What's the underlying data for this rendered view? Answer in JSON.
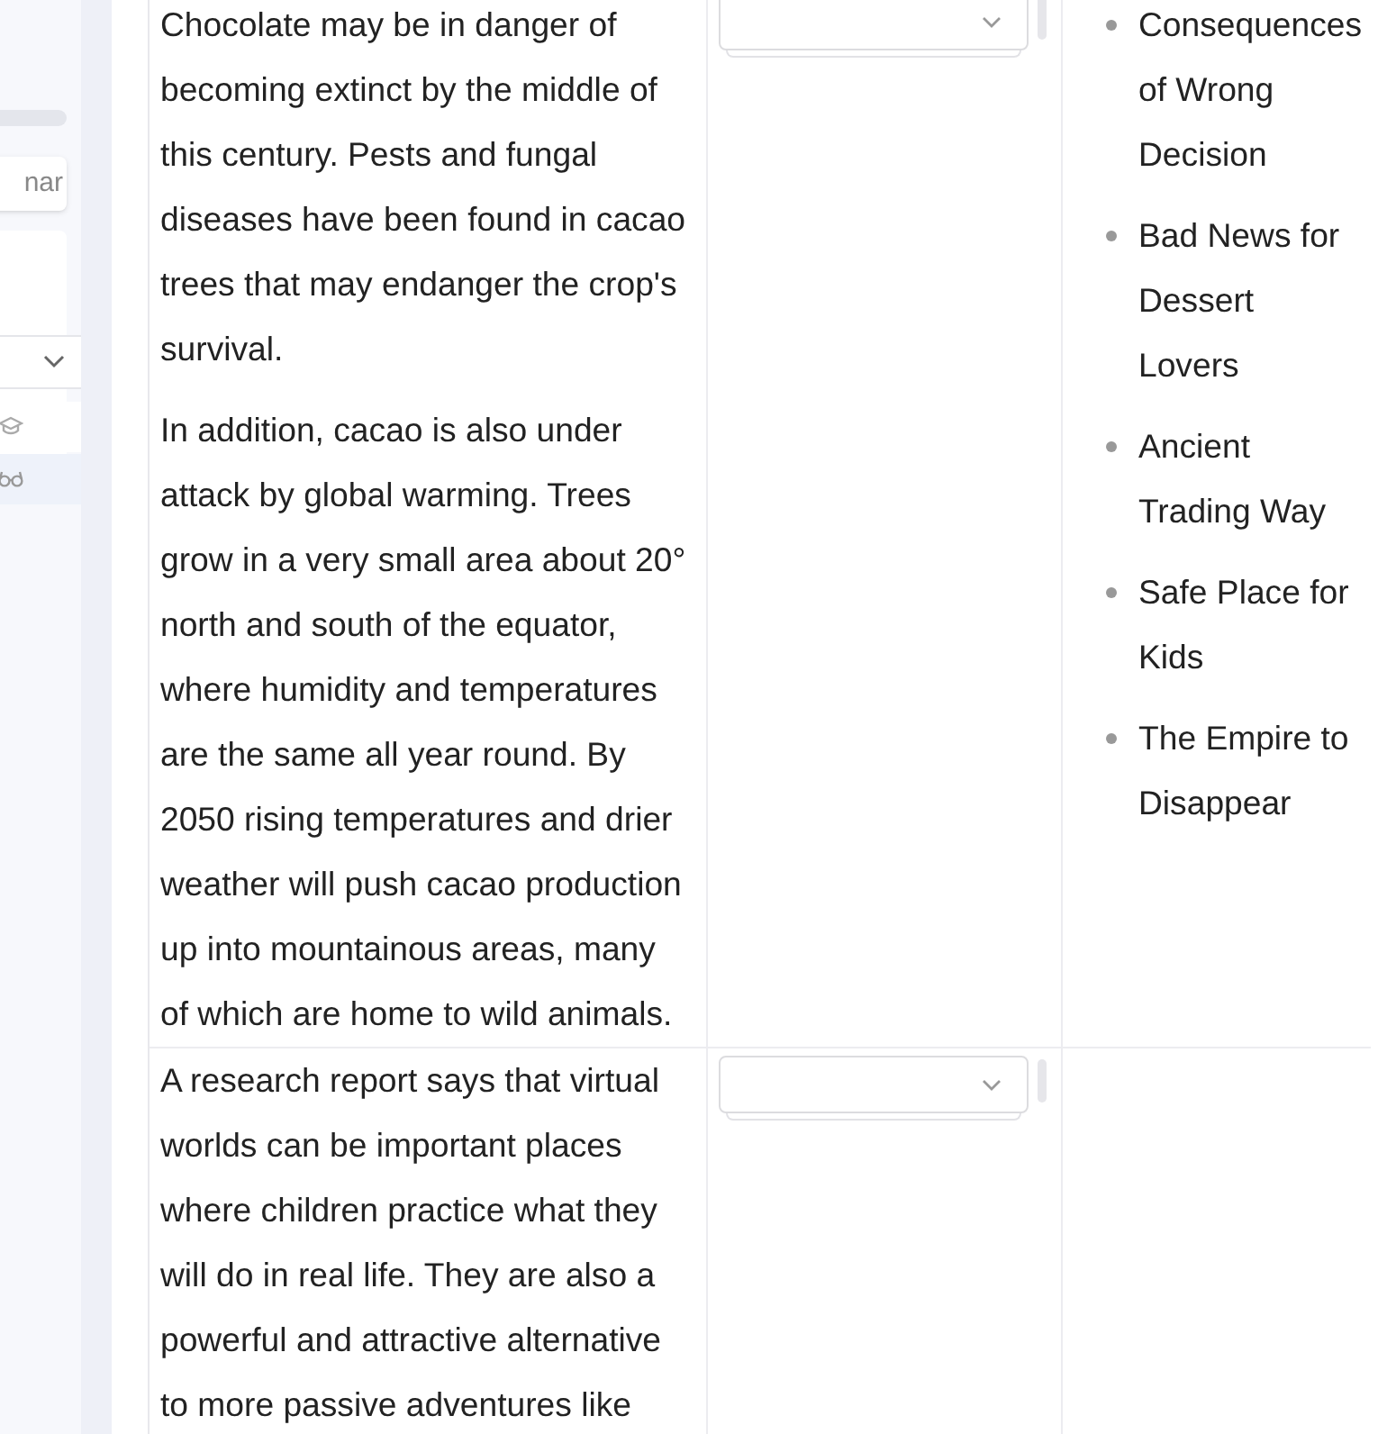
{
  "sidebar": {
    "button_fragment": "nar",
    "items": [
      {
        "kind": "cap",
        "selected": false
      },
      {
        "kind": "glasses",
        "selected": true
      }
    ]
  },
  "rows": [
    {
      "paragraphs": [
        [
          "Chocolate may be in danger of",
          "becoming extinct by the middle of",
          "this century. Pests and fungal",
          "diseases have been found in cacao",
          "trees that may endanger the crop's",
          "survival."
        ],
        [
          "In addition, cacao is also under",
          "attack by global warming. Trees",
          "grow in a very small area about 20°",
          "north and south of the equator,",
          "where humidity and temperatures",
          "are the same all year round. By",
          "2050 rising temperatures and drier",
          "weather will push cacao production",
          "up into mountainous areas, many",
          "of which are home to wild animals."
        ]
      ],
      "options": [
        [
          "Consequences",
          "of Wrong",
          "Decision"
        ],
        [
          "Bad News for",
          "Dessert",
          "Lovers"
        ],
        [
          "Ancient",
          "Trading Way"
        ],
        [
          "Safe Place for",
          "Kids"
        ],
        [
          "The Empire to",
          "Disappear"
        ]
      ]
    },
    {
      "paragraphs": [
        [
          "A research report says that virtual",
          "worlds can be important places",
          "where children practice what they",
          "will do in real life. They are also a",
          "powerful and attractive alternative",
          "to more passive adventures like"
        ]
      ],
      "options": []
    }
  ]
}
